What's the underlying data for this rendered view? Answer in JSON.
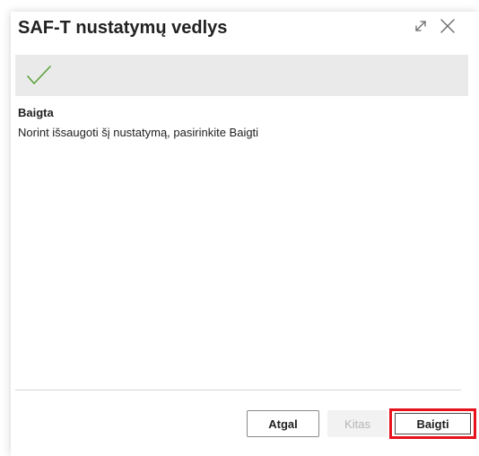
{
  "dialog": {
    "title": "SAF-T nustatymų vedlys",
    "expand_icon": "expand-arrows-icon",
    "close_icon": "close-x-icon"
  },
  "step": {
    "status_icon": "checkmark-icon",
    "check_color": "#5aa13a"
  },
  "content": {
    "heading": "Baigta",
    "text": "Norint išsaugoti šį nustatymą, pasirinkite Baigti"
  },
  "footer": {
    "back_label": "Atgal",
    "next_label": "Kitas",
    "finish_label": "Baigti",
    "highlight_color": "#e8121d"
  }
}
